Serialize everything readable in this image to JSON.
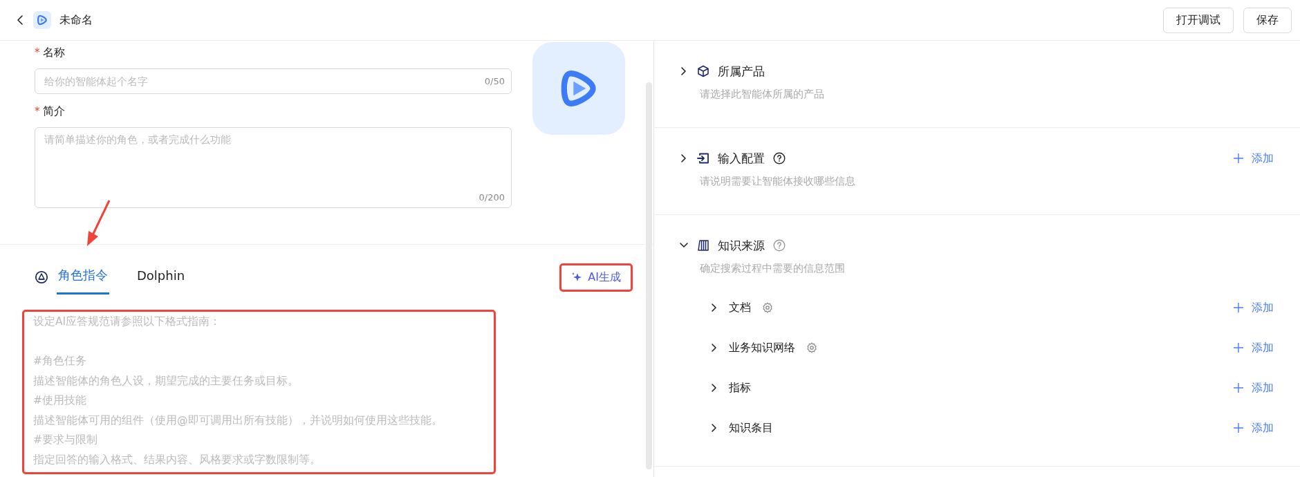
{
  "header": {
    "title": "未命名",
    "buttons": [
      {
        "label": "打开调试"
      },
      {
        "label": "保存"
      }
    ]
  },
  "form": {
    "fields": [
      {
        "label": "名称",
        "required_mark": "*",
        "kind": "input",
        "placeholder": "给你的智能体起个名字",
        "counter": "0/50"
      },
      {
        "label": "简介",
        "required_mark": "*",
        "kind": "textarea",
        "placeholder": "请简单描述你的角色，或者完成什么功能",
        "counter": "0/200"
      }
    ]
  },
  "tabs": [
    {
      "label": "角色指令",
      "selected": true,
      "pointed": true
    },
    {
      "label": "Dolphin",
      "selected": false,
      "pointed": false
    }
  ],
  "ai_button": {
    "label": "AI生成",
    "highlighted": true
  },
  "prompt": {
    "highlighted": true,
    "intro": "设定AI应答规范请参照以下格式指南：",
    "parts": [
      {
        "heading": "#角色任务",
        "text": "描述智能体的角色人设，期望完成的主要任务或目标。"
      },
      {
        "heading": "#使用技能",
        "text": "描述智能体可用的组件（使用@即可调用出所有技能），并说明如何使用这些技能。"
      },
      {
        "heading": "#要求与限制",
        "text": "指定回答的输入格式、结果内容、风格要求或字数限制等。"
      }
    ]
  },
  "sections": [
    {
      "kind": "product",
      "title": "所属产品",
      "expanded": false,
      "help": false,
      "description": "请选择此智能体所属的产品"
    },
    {
      "kind": "input",
      "title": "输入配置",
      "expanded": false,
      "help": true,
      "add_label": "添加",
      "description": "请说明需要让智能体接收哪些信息"
    },
    {
      "kind": "knowledge",
      "title": "知识来源",
      "expanded": true,
      "help": true,
      "description": "确定搜索过程中需要的信息范围",
      "children": [
        {
          "title": "文档",
          "expanded": false,
          "settings": true,
          "add_label": "添加"
        },
        {
          "title": "业务知识网络",
          "expanded": false,
          "settings": true,
          "add_label": "添加"
        },
        {
          "title": "指标",
          "expanded": false,
          "settings": false,
          "add_label": "添加"
        },
        {
          "title": "知识条目",
          "expanded": false,
          "settings": false,
          "add_label": "添加"
        }
      ]
    }
  ]
}
